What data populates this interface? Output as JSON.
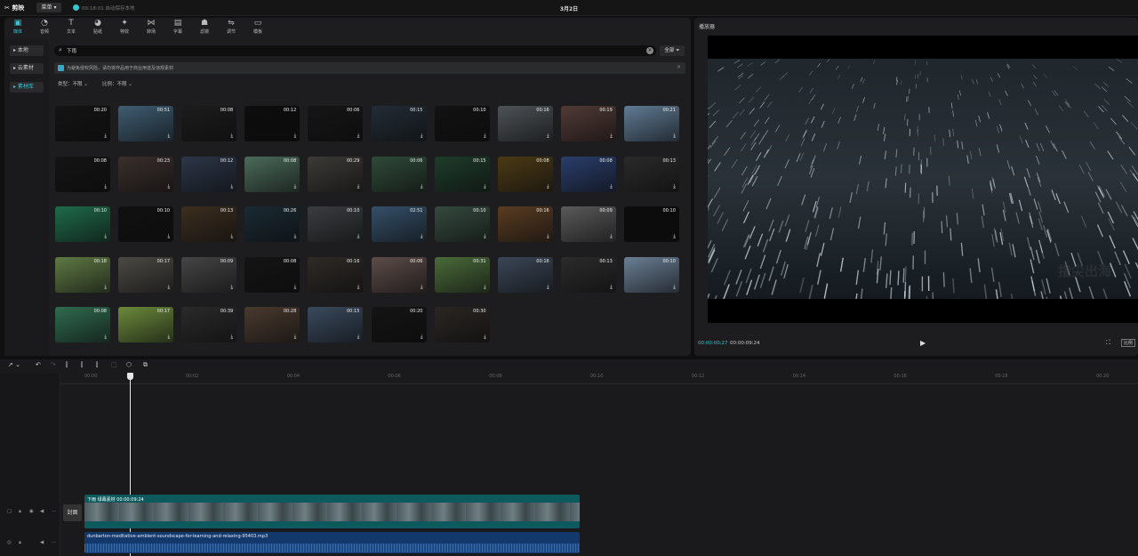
{
  "titlebar": {
    "app_name": "剪映",
    "menu_label": "菜单",
    "save_status": "00:18:01 自动保存本地",
    "project_title": "3月2日"
  },
  "tabs": [
    {
      "label": "媒体",
      "icon": "▣"
    },
    {
      "label": "音频",
      "icon": "◔"
    },
    {
      "label": "文本",
      "icon": "T"
    },
    {
      "label": "贴纸",
      "icon": "◕"
    },
    {
      "label": "特效",
      "icon": "✦"
    },
    {
      "label": "转场",
      "icon": "⋈"
    },
    {
      "label": "字幕",
      "icon": "▤"
    },
    {
      "label": "滤镜",
      "icon": "☗"
    },
    {
      "label": "调节",
      "icon": "⇋"
    },
    {
      "label": "模板",
      "icon": "▭"
    }
  ],
  "side_nav": [
    {
      "label": "本地"
    },
    {
      "label": "云素材"
    },
    {
      "label": "素材库"
    }
  ],
  "search": {
    "value": "下雨",
    "filter_label": "全部"
  },
  "notice": {
    "text": "为避免侵权风险，请勿将作品用于商业用途及违规素材"
  },
  "filters": {
    "type_label": "类型：不限",
    "ratio_label": "比例：不限"
  },
  "thumbnails": [
    {
      "duration": "00:20",
      "color": "#141414"
    },
    {
      "duration": "00:51",
      "color": "#3f5d72"
    },
    {
      "duration": "00:08",
      "color": "#1c1c1c"
    },
    {
      "duration": "00:12",
      "color": "#0d0d0d"
    },
    {
      "duration": "00:06",
      "color": "#151515"
    },
    {
      "duration": "00:15",
      "color": "#222c35"
    },
    {
      "duration": "00:10",
      "color": "#121212"
    },
    {
      "duration": "00:16",
      "color": "#4c5256"
    },
    {
      "duration": "00:19",
      "color": "#513a36"
    },
    {
      "duration": "00:21",
      "color": "#607b94"
    },
    {
      "duration": "00:08",
      "color": "#141414"
    },
    {
      "duration": "00:23",
      "color": "#3a2f2b"
    },
    {
      "duration": "00:12",
      "color": "#2c3648"
    },
    {
      "duration": "00:08",
      "color": "#4b6b5a"
    },
    {
      "duration": "00:29",
      "color": "#3c3a36"
    },
    {
      "duration": "00:06",
      "color": "#2f4a38"
    },
    {
      "duration": "00:15",
      "color": "#1e3c2a"
    },
    {
      "duration": "00:08",
      "color": "#4b3a15"
    },
    {
      "duration": "00:08",
      "color": "#2a3d6b"
    },
    {
      "duration": "00:13",
      "color": "#2a2a2a"
    },
    {
      "duration": "00:10",
      "color": "#1f6b4a"
    },
    {
      "duration": "00:10",
      "color": "#111111"
    },
    {
      "duration": "00:13",
      "color": "#3c2e1f"
    },
    {
      "duration": "00:26",
      "color": "#1a2a33"
    },
    {
      "duration": "00:10",
      "color": "#3a3d40"
    },
    {
      "duration": "02:51",
      "color": "#355069"
    },
    {
      "duration": "00:10",
      "color": "#354a3e"
    },
    {
      "duration": "00:16",
      "color": "#5a3c22"
    },
    {
      "duration": "00:09",
      "color": "#5a5a5a"
    },
    {
      "duration": "00:10",
      "color": "#0c0c0c"
    },
    {
      "duration": "00:18",
      "color": "#5f7a44"
    },
    {
      "duration": "00:17",
      "color": "#4b4a44"
    },
    {
      "duration": "00:09",
      "color": "#454545"
    },
    {
      "duration": "00:08",
      "color": "#141414"
    },
    {
      "duration": "00:16",
      "color": "#2e2a26"
    },
    {
      "duration": "00:06",
      "color": "#5c4c48"
    },
    {
      "duration": "00:31",
      "color": "#4a6b3a"
    },
    {
      "duration": "00:16",
      "color": "#3b4656"
    },
    {
      "duration": "00:13",
      "color": "#2b2b2b"
    },
    {
      "duration": "00:10",
      "color": "#6a7f95"
    },
    {
      "duration": "00:08",
      "color": "#2f6b4f"
    },
    {
      "duration": "00:17",
      "color": "#6b8a3b"
    },
    {
      "duration": "00:39",
      "color": "#2a2a2a"
    },
    {
      "duration": "00:28",
      "color": "#4a3a2e"
    },
    {
      "duration": "00:15",
      "color": "#3a4a5e"
    },
    {
      "duration": "00:20",
      "color": "#141414"
    },
    {
      "duration": "00:30",
      "color": "#2a2622"
    }
  ],
  "player": {
    "title": "播放器",
    "current_time": "00:00:00:27",
    "total_time": "00:00:09:24",
    "watermark": "指尖出海",
    "ratio_label": "比例"
  },
  "timeline": {
    "ticks": [
      "00:00",
      "00:02",
      "00:04",
      "00:06",
      "00:08",
      "00:10",
      "00:12",
      "00:14",
      "00:16",
      "00:18",
      "00:20"
    ],
    "cover_label": "封面",
    "video_clip_label": "下雨 绿幕素材  00:00:09:24",
    "audio_clip_label": "dunbarton-meditative-ambient-soundscape-for-learning-and-relaxing-95403.mp3"
  }
}
